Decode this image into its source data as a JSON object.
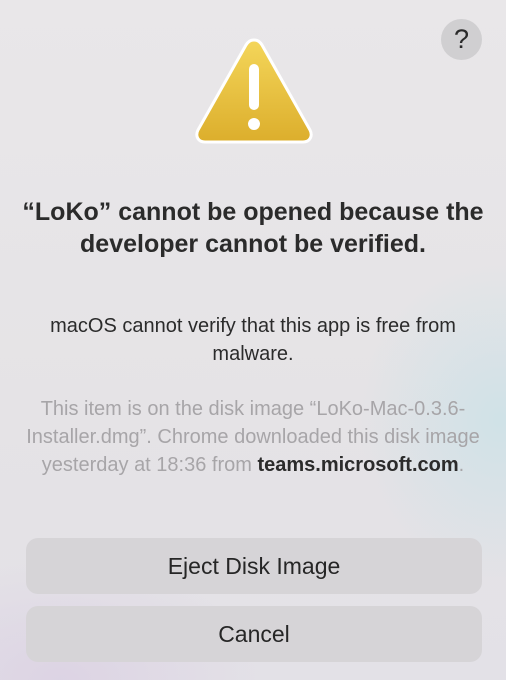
{
  "dialog": {
    "help_label": "?",
    "title": "“LoKo” cannot be opened because the developer cannot be verified.",
    "message": "macOS cannot verify that this app is free from malware.",
    "info_prefix": "This item is on the disk image “LoKo-Mac-0.3.6-Installer.dmg”. Chrome downloaded this disk image yesterday at 18:36 from ",
    "info_host": "teams.microsoft.com",
    "info_suffix": ".",
    "icon": "warning-triangle-icon"
  },
  "buttons": {
    "eject_label": "Eject Disk Image",
    "cancel_label": "Cancel"
  },
  "colors": {
    "warning_fill": "#e7bd3c",
    "button_bg": "#d6d4d7",
    "secondary_text": "#a7a5a8"
  }
}
